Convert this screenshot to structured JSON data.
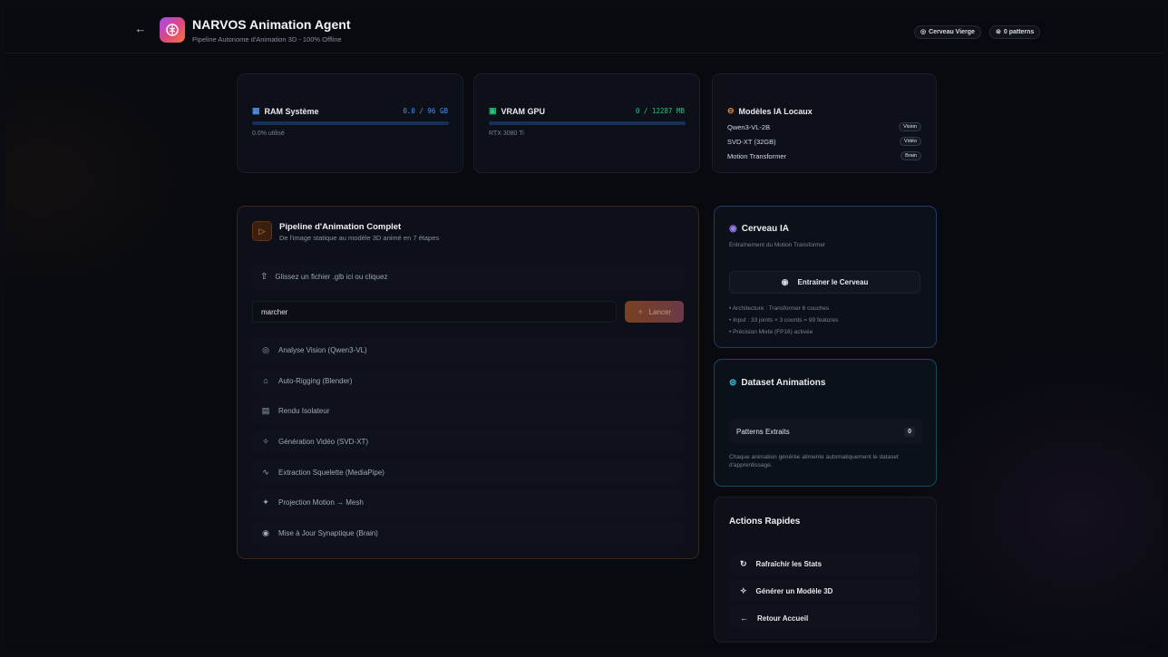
{
  "header": {
    "title": "NARVOS Animation Agent",
    "subtitle": "Pipeline Autonome d'Animation 3D - 100% Offline",
    "badges": [
      {
        "label": "Cerveau Vierge",
        "icon": "brain-icon"
      },
      {
        "label": "0 patterns",
        "icon": "database-icon"
      }
    ]
  },
  "stats": {
    "ram": {
      "title": "RAM Système",
      "value": "0.0 / 96 GB",
      "caption": "0.0% utilisé",
      "fraction": 0.0
    },
    "vram": {
      "title": "VRAM GPU",
      "value": "0 / 12287 MB",
      "caption": "RTX 3080 Ti",
      "fraction": 0.0
    },
    "models": {
      "title": "Modèles IA Locaux",
      "items": [
        {
          "name": "Qwen3-VL-2B",
          "tag": "Vision"
        },
        {
          "name": "SVD-XT (32GB)",
          "tag": "Vidéo"
        },
        {
          "name": "Motion Transformer",
          "tag": "Brain"
        }
      ]
    }
  },
  "pipeline": {
    "title": "Pipeline d'Animation Complet",
    "subtitle": "De l'image statique au modèle 3D animé en 7 étapes",
    "upload_label": "Glissez un fichier .glb ici ou cliquez",
    "prompt_value": "marcher",
    "launch_label": "Lancer",
    "steps": [
      {
        "label": "Analyse Vision (Qwen3-VL)",
        "icon": "eye-icon"
      },
      {
        "label": "Auto-Rigging (Blender)",
        "icon": "rig-icon"
      },
      {
        "label": "Rendu Isolateur",
        "icon": "film-icon"
      },
      {
        "label": "Génération Vidéo (SVD-XT)",
        "icon": "sparkles-icon"
      },
      {
        "label": "Extraction Squelette (MediaPipe)",
        "icon": "activity-icon"
      },
      {
        "label": "Projection Motion → Mesh",
        "icon": "projection-icon"
      },
      {
        "label": "Mise à Jour Synaptique (Brain)",
        "icon": "brain-icon"
      }
    ]
  },
  "brain": {
    "title": "Cerveau IA",
    "subtitle": "Entraînement du Motion Transformer",
    "train_label": "Entraîner le Cerveau",
    "notes": [
      "• Architecture : Transformer 6 couches",
      "• Input : 33 joints × 3 coords = 99 features",
      "• Précision Mixte (FP16) activée"
    ]
  },
  "dataset": {
    "title": "Dataset Animations",
    "patterns_label": "Patterns Extraits",
    "patterns_count": "0",
    "description": "Chaque animation générée alimente automatiquement le dataset d'apprentissage."
  },
  "quick_actions": {
    "title": "Actions Rapides",
    "items": [
      {
        "label": "Rafraîchir les Stats",
        "icon": "refresh-icon"
      },
      {
        "label": "Générer un Modèle 3D",
        "icon": "sparkles-icon"
      },
      {
        "label": "Retour Accueil",
        "icon": "arrow-left-icon"
      }
    ]
  },
  "colors": {
    "background": "#080a10",
    "accent_orange": "#e0782e",
    "ram_blue": "#4b8fe8",
    "vram_green": "#22c778",
    "models_orange": "#f0892f",
    "brain_purple": "#9b7bff",
    "dataset_cyan": "#38bde0",
    "brain_border": "#1f3b66",
    "dataset_border": "#184a5c"
  }
}
